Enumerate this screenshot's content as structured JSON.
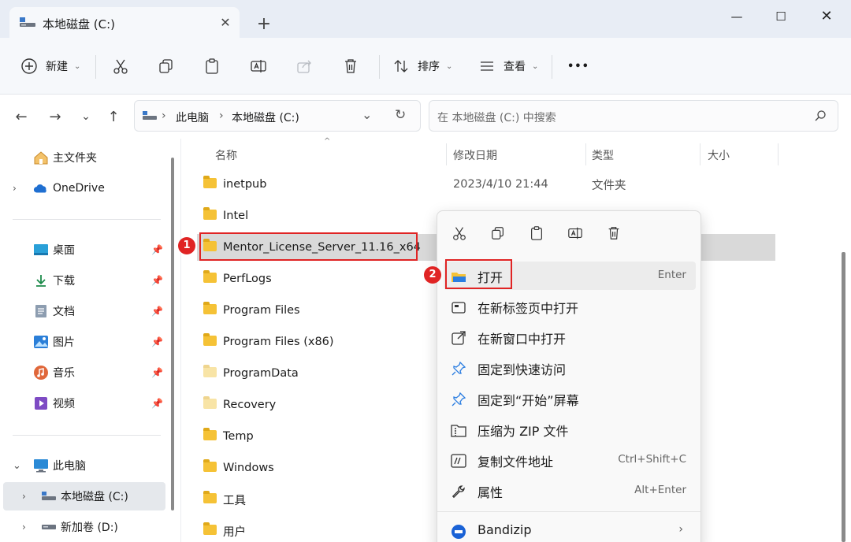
{
  "window": {
    "tab_title": "本地磁盘 (C:)",
    "tab_close": "✕",
    "new_tab": "+",
    "minimize": "—",
    "maximize": "☐",
    "close": "✕"
  },
  "toolbar": {
    "new_label": "新建",
    "sort_label": "排序",
    "view_label": "查看",
    "more_label": "•••"
  },
  "address": {
    "crumbs": [
      "此电脑",
      "本地磁盘 (C:)"
    ],
    "search_placeholder": "在 本地磁盘 (C:) 中搜索"
  },
  "sidebar": {
    "items": [
      {
        "label": "主文件夹"
      },
      {
        "label": "OneDrive"
      },
      {
        "label": "桌面"
      },
      {
        "label": "下载"
      },
      {
        "label": "文档"
      },
      {
        "label": "图片"
      },
      {
        "label": "音乐"
      },
      {
        "label": "视频"
      },
      {
        "label": "此电脑"
      },
      {
        "label": "本地磁盘 (C:)"
      },
      {
        "label": "新加卷 (D:)"
      }
    ]
  },
  "columns": {
    "name": "名称",
    "date": "修改日期",
    "type": "类型",
    "size": "大小"
  },
  "files": [
    {
      "name": "inetpub",
      "date": "2023/4/10 21:44",
      "type": "文件夹"
    },
    {
      "name": "Intel",
      "date": "",
      "type": ""
    },
    {
      "name": "Mentor_License_Server_11.16_x64",
      "date": "",
      "type": ""
    },
    {
      "name": "PerfLogs",
      "date": "",
      "type": ""
    },
    {
      "name": "Program Files",
      "date": "",
      "type": ""
    },
    {
      "name": "Program Files (x86)",
      "date": "",
      "type": ""
    },
    {
      "name": "ProgramData",
      "date": "",
      "type": ""
    },
    {
      "name": "Recovery",
      "date": "",
      "type": ""
    },
    {
      "name": "Temp",
      "date": "",
      "type": ""
    },
    {
      "name": "Windows",
      "date": "",
      "type": ""
    },
    {
      "name": "工具",
      "date": "",
      "type": ""
    },
    {
      "name": "用户",
      "date": "",
      "type": ""
    }
  ],
  "annotations": {
    "badge1": "1",
    "badge2": "2"
  },
  "context_menu": {
    "items": [
      {
        "label": "打开",
        "shortcut": "Enter",
        "icon": "folder-open-icon"
      },
      {
        "label": "在新标签页中打开",
        "shortcut": "",
        "icon": "new-tab-icon"
      },
      {
        "label": "在新窗口中打开",
        "shortcut": "",
        "icon": "new-window-icon"
      },
      {
        "label": "固定到快速访问",
        "shortcut": "",
        "icon": "pin-icon"
      },
      {
        "label": "固定到“开始”屏幕",
        "shortcut": "",
        "icon": "pin-icon"
      },
      {
        "label": "压缩为 ZIP 文件",
        "shortcut": "",
        "icon": "zip-icon"
      },
      {
        "label": "复制文件地址",
        "shortcut": "Ctrl+Shift+C",
        "icon": "copy-path-icon"
      },
      {
        "label": "属性",
        "shortcut": "Alt+Enter",
        "icon": "wrench-icon"
      },
      {
        "label": "Bandizip",
        "shortcut": "",
        "icon": "bandizip-icon"
      }
    ],
    "submenu_arrow": "›"
  },
  "colors": {
    "highlight": "#e02424",
    "folder": "#f5c236",
    "selection": "#d9d9d9"
  }
}
